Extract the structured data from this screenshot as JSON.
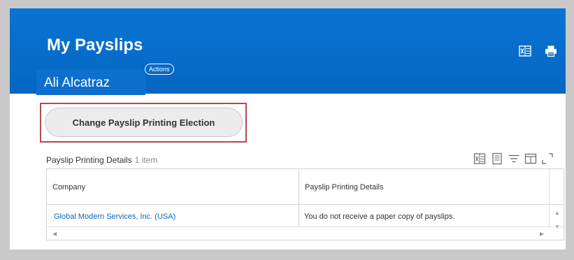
{
  "header": {
    "title": "My Payslips",
    "user_name": "Ali Alcatraz",
    "actions_label": "Actions",
    "icons": [
      "excel-export-icon",
      "print-icon"
    ]
  },
  "primary_button": {
    "label": "Change Payslip Printing Election"
  },
  "section": {
    "title": "Payslip Printing Details",
    "count": "1 item",
    "toolbar_icons": [
      "excel-export-icon",
      "view-icon",
      "filter-icon",
      "columns-icon",
      "fullscreen-icon"
    ]
  },
  "table": {
    "columns": [
      "Company",
      "Payslip Printing Details"
    ],
    "rows": [
      {
        "company": "Global Modern Services, Inc. (USA)",
        "details": "You do not receive a paper copy of payslips."
      }
    ]
  },
  "colors": {
    "header_blue": "#0a74d4",
    "link_blue": "#0c64c8",
    "highlight_red": "#b54a4a"
  }
}
